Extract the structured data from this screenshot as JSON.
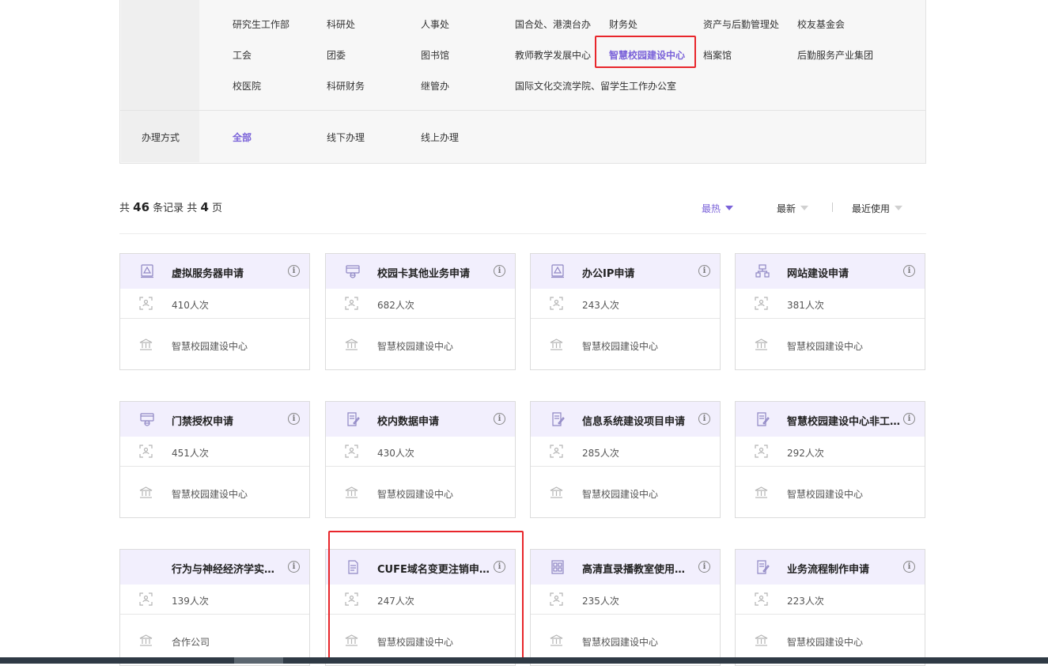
{
  "departments": [
    [
      "研究生工作部",
      "科研处",
      "人事处",
      "国合处、港澳台办",
      "财务处",
      "资产与后勤管理处",
      "校友基金会"
    ],
    [
      "工会",
      "团委",
      "图书馆",
      "教师教学发展中心",
      "智慧校园建设中心",
      "档案馆",
      "后勤服务产业集团"
    ],
    [
      "校医院",
      "科研财务",
      "继管办",
      "国际文化交流学院、留学生工作办公室"
    ]
  ],
  "active_department": "智慧校园建设中心",
  "mode": {
    "label": "办理方式",
    "options": [
      "全部",
      "线下办理",
      "线上办理"
    ],
    "active": "全部"
  },
  "summary": {
    "prefix": "共",
    "records": "46",
    "mid": "条记录 共",
    "pages": "4",
    "suffix": "页"
  },
  "sort": {
    "hot": "最热",
    "new": "最新",
    "recent": "最近使用"
  },
  "cards": [
    {
      "title": "虚拟服务器申请",
      "count": "410人次",
      "dept": "智慧校园建设中心",
      "icon": "server-doc-icon"
    },
    {
      "title": "校园卡其他业务申请",
      "count": "682人次",
      "dept": "智慧校园建设中心",
      "icon": "card-web-icon"
    },
    {
      "title": "办公IP申请",
      "count": "243人次",
      "dept": "智慧校园建设中心",
      "icon": "server-doc-icon"
    },
    {
      "title": "网站建设申请",
      "count": "381人次",
      "dept": "智慧校园建设中心",
      "icon": "network-icon"
    },
    {
      "title": "门禁授权申请",
      "count": "451人次",
      "dept": "智慧校园建设中心",
      "icon": "card-web-icon"
    },
    {
      "title": "校内数据申请",
      "count": "430人次",
      "dept": "智慧校园建设中心",
      "icon": "form-edit-icon"
    },
    {
      "title": "信息系统建设项目申请",
      "count": "285人次",
      "dept": "智慧校园建设中心",
      "icon": "form-edit-icon"
    },
    {
      "title": "智慧校园建设中心非工…",
      "count": "292人次",
      "dept": "智慧校园建设中心",
      "icon": "form-edit-icon"
    },
    {
      "title": "行为与神经经济学实…",
      "count": "139人次",
      "dept": "合作公司",
      "icon": ""
    },
    {
      "title": "CUFE域名变更注销申…",
      "count": "247人次",
      "dept": "智慧校园建设中心",
      "icon": "doc-icon"
    },
    {
      "title": "高清直录播教室使用…",
      "count": "235人次",
      "dept": "智慧校园建设中心",
      "icon": "grid-doc-icon"
    },
    {
      "title": "业务流程制作申请",
      "count": "223人次",
      "dept": "智慧校园建设中心",
      "icon": "form-edit-icon"
    }
  ]
}
